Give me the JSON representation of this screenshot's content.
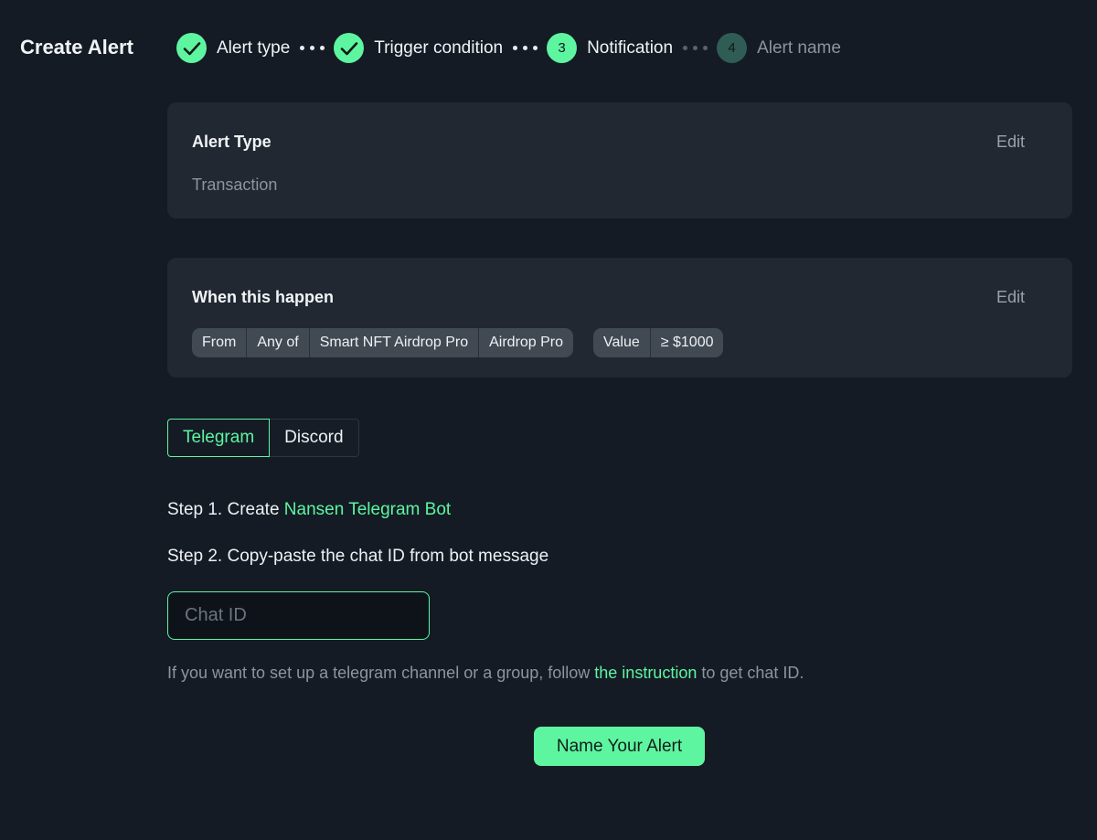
{
  "header": {
    "title": "Create Alert",
    "steps": [
      {
        "number": "1",
        "label": "Alert type",
        "state": "done"
      },
      {
        "number": "2",
        "label": "Trigger condition",
        "state": "done"
      },
      {
        "number": "3",
        "label": "Notification",
        "state": "active"
      },
      {
        "number": "4",
        "label": "Alert name",
        "state": "pending"
      }
    ]
  },
  "alert_type_card": {
    "title": "Alert Type",
    "edit_label": "Edit",
    "value": "Transaction"
  },
  "condition_card": {
    "title": "When this happen",
    "edit_label": "Edit",
    "chip_groups": [
      [
        "From",
        "Any of",
        "Smart NFT Airdrop Pro",
        "Airdrop Pro"
      ],
      [
        "Value",
        "≥ $1000"
      ]
    ]
  },
  "tabs": [
    {
      "label": "Telegram",
      "active": true
    },
    {
      "label": "Discord",
      "active": false
    }
  ],
  "instructions": {
    "step1_prefix": "Step 1. Create ",
    "step1_link": "Nansen Telegram Bot",
    "step2": "Step 2. Copy-paste the chat ID from bot message"
  },
  "chat_id_input": {
    "placeholder": "Chat ID",
    "value": ""
  },
  "help": {
    "prefix": "If you want to set up a telegram channel or a group, follow ",
    "link": "the instruction",
    "suffix": " to get chat ID."
  },
  "primary_button": {
    "label": "Name Your Alert"
  },
  "colors": {
    "accent": "#5ef5a1",
    "background": "#141b24",
    "card": "#212831"
  }
}
